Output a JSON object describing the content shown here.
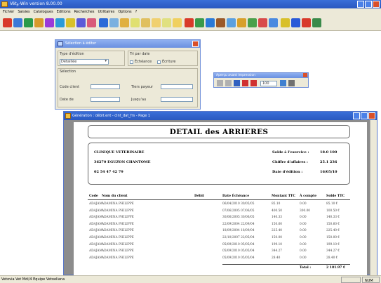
{
  "app": {
    "title": "Vétو-Win version 8.00.00",
    "menu": [
      "Fichier",
      "Saisies",
      "Catalogues",
      "Editions",
      "Recherches",
      "Utilitaires",
      "Options",
      "?"
    ],
    "status_text": "Vetovia Vet  Mdi/4 Equipe Vetoeliana",
    "status_right": "NUM"
  },
  "toolbar": {
    "icons": [
      "clients-icon",
      "rdv-icon",
      "fiche-icon",
      "stock-icon",
      "animal-icon",
      "facture-icon",
      "reglement-icon",
      "medic-icon",
      "agenda-icon",
      "catalogue-icon",
      "courrier-icon",
      "stats-icon",
      "doc-icon",
      "copy-icon",
      "paste-icon",
      "find-icon",
      "help-icon",
      "person-icon",
      "group-icon",
      "tree-icon",
      "report-icon",
      "mail-icon",
      "phone-icon",
      "calc-icon",
      "note-icon",
      "chart-icon",
      "exit-icon",
      "config-icon",
      "tools-icon",
      "globe-icon"
    ]
  },
  "selection_dialog": {
    "title": "Sélection à éditer",
    "type_label": "Type d'édition",
    "type_value": "Détaillée",
    "date_label": "Tri par date",
    "date_option_1": "Échéance",
    "date_option_2": "Écriture",
    "select_label": "Sélection",
    "code_client_label": "Code client",
    "name_label": "Tiers payeur",
    "date_from_label": "Date de",
    "date_to_label": "Jusqu'au"
  },
  "preview_palette": {
    "title": "Aperçu avant impression",
    "zoom_value": "100"
  },
  "report_window": {
    "title": "Génération : débit.ent - clnt_dat_frs - Page 1",
    "report_title": "DETAIL des ARRIERES",
    "clinic_name": "CLINIQUE VETERINAIRE",
    "clinic_address": "36270 EGUZON CHANTOME",
    "clinic_phone": "02 54 47 42 79",
    "summary": [
      {
        "label": "Solde à l'exercice :",
        "value": "18.0 100"
      },
      {
        "label": "Chiffre d'affaires :",
        "value": "25.1 236"
      },
      {
        "label": "Date d'édition :",
        "value": "16/05/10"
      }
    ],
    "columns": [
      "Code",
      "Nom du client",
      "Débit",
      "Date  Échéance",
      "Montant TTC",
      "À compte",
      "Solde TTC"
    ],
    "rows": [
      [
        "ADAJAM",
        "ADAMINA PHILIPPE",
        "",
        "06/04/2010  30/05/05",
        "85.10",
        "0.00",
        "85.10 €"
      ],
      [
        "ADAJAM",
        "ADAMINA PHILIPPE",
        "",
        "07/06/2005  07/06/05",
        "400.50",
        "300.00",
        "100.50 €"
      ],
      [
        "ADAJAM",
        "ADAMINA PHILIPPE",
        "",
        "30/06/2005  30/06/05",
        "140.33",
        "0.00",
        "140.33 €"
      ],
      [
        "ADAJAM",
        "ADAMINA PHILIPPE",
        "",
        "22/09/2004  22/09/04",
        "150.60",
        "0.00",
        "150.60 €"
      ],
      [
        "ADAJAM",
        "ADAMINA PHILIPPE",
        "",
        "18/09/2004  18/09/04",
        "225.40",
        "0.00",
        "225.40 €"
      ],
      [
        "ADAJAM",
        "ADAMINA PHILIPPE",
        "",
        "22/10/2007  22/05/04",
        "150.00",
        "0.00",
        "150.00 €"
      ],
      [
        "ADAJAM",
        "ADAMINA PHILIPPE",
        "",
        "05/09/2010  05/05/04",
        "199.10",
        "0.00",
        "199.10 €"
      ],
      [
        "ADAJAM",
        "ADAMINA PHILIPPE",
        "",
        "05/09/2010  05/05/04",
        "344.27",
        "0.00",
        "344.27 €"
      ],
      [
        "ADAJAM",
        "ADAMINA PHILIPPE",
        "",
        "05/09/2010  05/05/04",
        "28.40",
        "0.00",
        "28.40 €"
      ]
    ],
    "total_label": "Total :",
    "total_value": "2 181.97 €"
  }
}
